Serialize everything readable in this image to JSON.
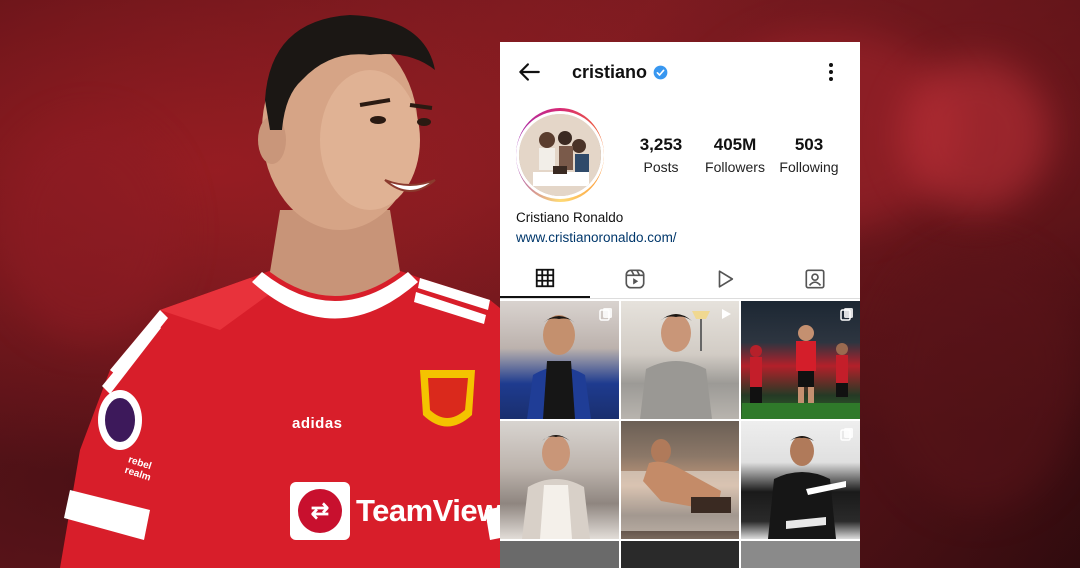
{
  "header": {
    "username": "cristiano"
  },
  "profile": {
    "posts_count": "3,253",
    "posts_label": "Posts",
    "followers_count": "405M",
    "followers_label": "Followers",
    "following_count": "503",
    "following_label": "Following",
    "full_name": "Cristiano Ronaldo",
    "website": "www.cristianoronaldo.com/"
  },
  "tabs": [
    {
      "name": "grid",
      "icon": "grid-icon",
      "active": true
    },
    {
      "name": "reels",
      "icon": "reels-icon",
      "active": false
    },
    {
      "name": "videos",
      "icon": "play-icon",
      "active": false
    },
    {
      "name": "tagged",
      "icon": "tagged-icon",
      "active": false
    }
  ],
  "shirt": {
    "brand": "adidas",
    "sponsor": "TeamViewer",
    "patch": "rebel\nrealm"
  },
  "colors": {
    "verified": "#3897f0",
    "link": "#00376b",
    "shirt_red": "#d81e2a"
  }
}
